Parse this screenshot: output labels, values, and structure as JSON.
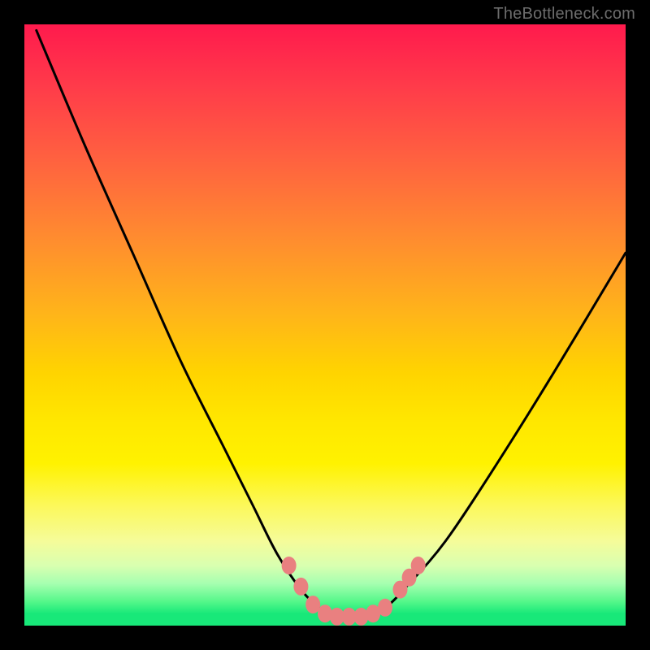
{
  "attribution": "TheBottleneck.com",
  "colors": {
    "frame": "#000000",
    "gradient_top": "#ff1a4d",
    "gradient_mid": "#ffd400",
    "gradient_bottom": "#18e879",
    "curve_stroke": "#000000",
    "marker_fill": "#e98080",
    "marker_stroke": "#cc5a5a"
  },
  "chart_data": {
    "type": "line",
    "title": "",
    "xlabel": "",
    "ylabel": "",
    "xlim": [
      0,
      100
    ],
    "ylim": [
      0,
      100
    ],
    "legend": false,
    "grid": false,
    "series": [
      {
        "name": "curve",
        "x": [
          2,
          10,
          18,
          26,
          33,
          38,
          42,
          46,
          49,
          52,
          56,
          60,
          64,
          70,
          78,
          88,
          100
        ],
        "y": [
          99,
          80,
          62,
          44,
          30,
          20,
          12,
          6,
          3,
          1.5,
          1.5,
          3,
          7,
          14,
          26,
          42,
          62
        ]
      }
    ],
    "markers": [
      {
        "x": 44,
        "y": 10
      },
      {
        "x": 46,
        "y": 6.5
      },
      {
        "x": 48,
        "y": 3.5
      },
      {
        "x": 50,
        "y": 2
      },
      {
        "x": 52,
        "y": 1.5
      },
      {
        "x": 54,
        "y": 1.5
      },
      {
        "x": 56,
        "y": 1.5
      },
      {
        "x": 58,
        "y": 2
      },
      {
        "x": 60,
        "y": 3
      },
      {
        "x": 62.5,
        "y": 6
      },
      {
        "x": 64,
        "y": 8
      },
      {
        "x": 65.5,
        "y": 10
      }
    ]
  }
}
